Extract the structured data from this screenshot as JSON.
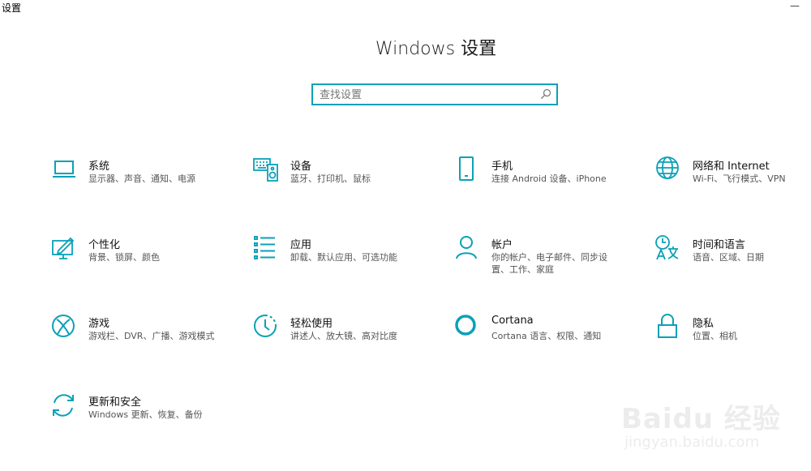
{
  "window": {
    "title": "设置",
    "minimize_glyph": "—"
  },
  "main": {
    "heading": "Windows 设置"
  },
  "search": {
    "placeholder": "查找设置",
    "value": ""
  },
  "accent": "#0aa1b8",
  "tiles": [
    {
      "icon": "laptop-icon",
      "name": "系统",
      "desc": "显示器、声音、通知、电源"
    },
    {
      "icon": "keyboard-speaker-icon",
      "name": "设备",
      "desc": "蓝牙、打印机、鼠标"
    },
    {
      "icon": "phone-icon",
      "name": "手机",
      "desc": "连接 Android 设备、iPhone"
    },
    {
      "icon": "globe-icon",
      "name": "网络和 Internet",
      "desc": "Wi-Fi、飞行模式、VPN"
    },
    {
      "icon": "paint-icon",
      "name": "个性化",
      "desc": "背景、锁屏、颜色"
    },
    {
      "icon": "list-icon",
      "name": "应用",
      "desc": "卸载、默认应用、可选功能"
    },
    {
      "icon": "person-icon",
      "name": "帐户",
      "desc": "你的帐户、电子邮件、同步设置、工作、家庭"
    },
    {
      "icon": "time-language-icon",
      "name": "时间和语言",
      "desc": "语音、区域、日期"
    },
    {
      "icon": "xbox-icon",
      "name": "游戏",
      "desc": "游戏栏、DVR、广播、游戏模式"
    },
    {
      "icon": "ease-of-access-icon",
      "name": "轻松使用",
      "desc": "讲述人、放大镜、高对比度"
    },
    {
      "icon": "cortana-icon",
      "name": "Cortana",
      "desc": "Cortana 语言、权限、通知"
    },
    {
      "icon": "lock-icon",
      "name": "隐私",
      "desc": "位置、相机"
    },
    {
      "icon": "sync-icon",
      "name": "更新和安全",
      "desc": "Windows 更新、恢复、备份"
    }
  ],
  "watermark": {
    "brand": "Baidu 经验",
    "url": "jingyan.baidu.com"
  }
}
